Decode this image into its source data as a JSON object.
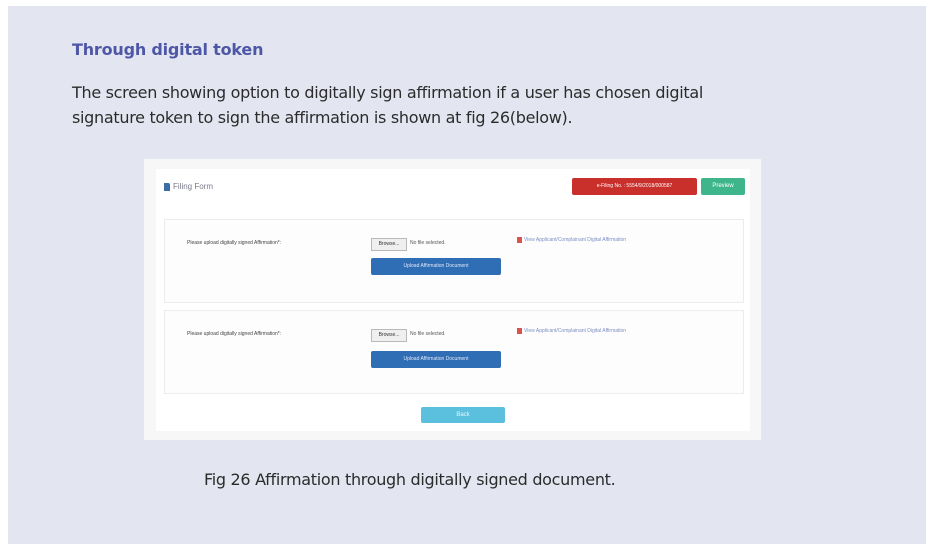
{
  "heading": "Through digital token",
  "paragraph_line1": "The screen showing option to digitally sign affirmation if a user has chosen digital",
  "paragraph_line2": "signature token to sign the affirmation is shown at fig 26(below).",
  "screenshot": {
    "form_title": "Filing Form",
    "efiling_button": "e-Filing No. : 5554/9/2018/000587",
    "preview_button": "Preview",
    "sections": [
      {
        "label": "Please upload digitally signed Affirmation*:",
        "browse_label": "Browse...",
        "file_status": "No file selected.",
        "view_link": "View Applicant/Complainant Digital Affirmation",
        "upload_button": "Upload Affirmation Document"
      },
      {
        "label": "Please upload digitally signed Affirmation*:",
        "browse_label": "Browse...",
        "file_status": "No file selected.",
        "view_link": "View Applicant/Complainant Digital Affirmation",
        "upload_button": "Upload Affirmation Document"
      }
    ],
    "back_button": "Back"
  },
  "caption": "Fig 26 Affirmation through digitally signed document.",
  "colors": {
    "panel_bg": "#e3e6f1",
    "heading": "#4e57a6",
    "efiling_red": "#c9302c",
    "preview_green": "#3fb58c",
    "upload_blue": "#2f6db5",
    "back_cyan": "#5bc0de"
  }
}
